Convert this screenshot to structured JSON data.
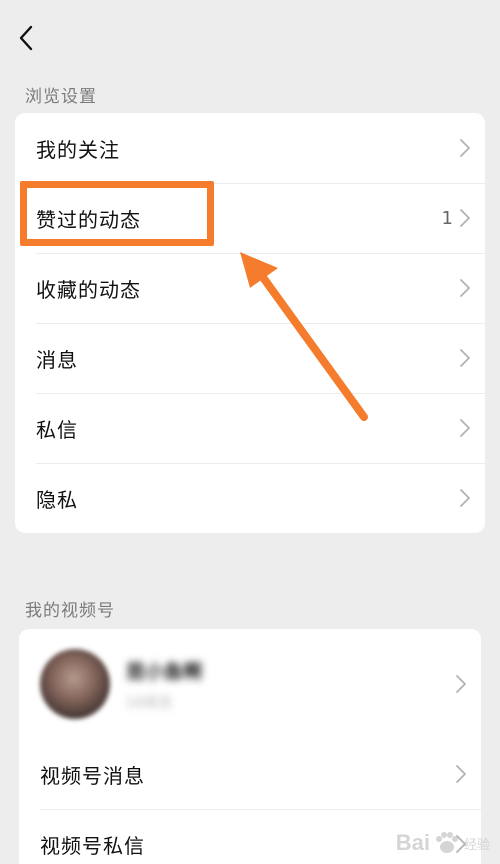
{
  "browse_section": {
    "title": "浏览设置",
    "items": [
      {
        "label": "我的关注",
        "count": ""
      },
      {
        "label": "赞过的动态",
        "count": "1"
      },
      {
        "label": "收藏的动态",
        "count": ""
      },
      {
        "label": "消息",
        "count": ""
      },
      {
        "label": "私信",
        "count": ""
      },
      {
        "label": "隐私",
        "count": ""
      }
    ]
  },
  "channels_section": {
    "title": "我的视频号",
    "profile": {
      "name": "昆小鱼啊",
      "sub": "14关注"
    },
    "items": [
      {
        "label": "视频号消息"
      },
      {
        "label": "视频号私信"
      }
    ]
  },
  "watermark": {
    "text": "Bai",
    "sub": "经验"
  },
  "colors": {
    "annotation": "#f47c2c",
    "background": "#ededed"
  }
}
